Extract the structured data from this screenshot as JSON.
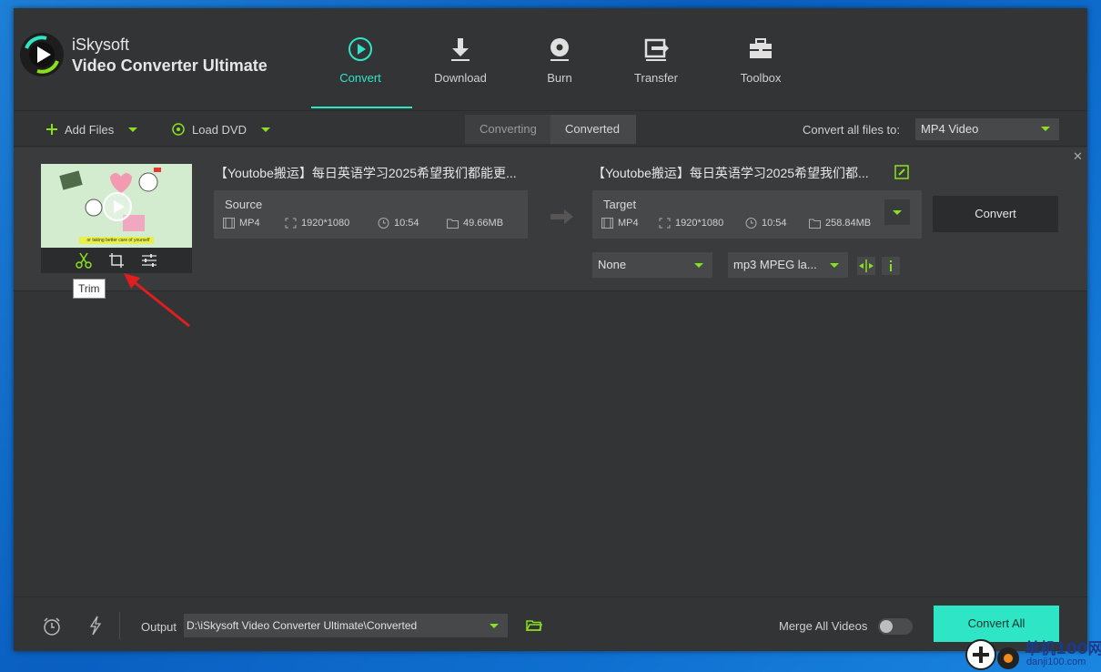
{
  "brand": {
    "line1": "iSkysoft",
    "line2": "Video Converter Ultimate"
  },
  "nav": [
    {
      "label": "Convert",
      "icon": "convert-icon",
      "active": true
    },
    {
      "label": "Download",
      "icon": "download-icon"
    },
    {
      "label": "Burn",
      "icon": "burn-icon"
    },
    {
      "label": "Transfer",
      "icon": "transfer-icon"
    },
    {
      "label": "Toolbox",
      "icon": "toolbox-icon"
    }
  ],
  "toolbar": {
    "add_files": "Add Files",
    "load_dvd": "Load DVD",
    "tab_converting": "Converting",
    "tab_converted": "Converted",
    "convert_all_to_label": "Convert all files to:",
    "convert_all_to_value": "MP4 Video"
  },
  "file": {
    "source_name": "【Youtobe搬运】每日英语学习2025希望我们都能更...",
    "target_name": "【Youtobe搬运】每日英语学习2025希望我们都...",
    "source": {
      "header": "Source",
      "format": "MP4",
      "resolution": "1920*1080",
      "duration": "10:54",
      "size": "49.66MB"
    },
    "target": {
      "header": "Target",
      "format": "MP4",
      "resolution": "1920*1080",
      "duration": "10:54",
      "size": "258.84MB"
    },
    "convert_label": "Convert",
    "subtitle_select": "None",
    "audio_select": "mp3 MPEG la...",
    "thumb_caption": "or taking better care of yourself",
    "tooltip": "Trim"
  },
  "bottom": {
    "output_label": "Output",
    "output_path": "D:\\iSkysoft Video Converter Ultimate\\Converted",
    "merge_label": "Merge All Videos",
    "merge_on": false,
    "convert_all": "Convert All"
  },
  "watermark": {
    "text1": "单机100网",
    "text2": "danji100.com"
  },
  "colors": {
    "accent": "#2ee6c6",
    "lime": "#8be01e",
    "bg": "#333436"
  }
}
